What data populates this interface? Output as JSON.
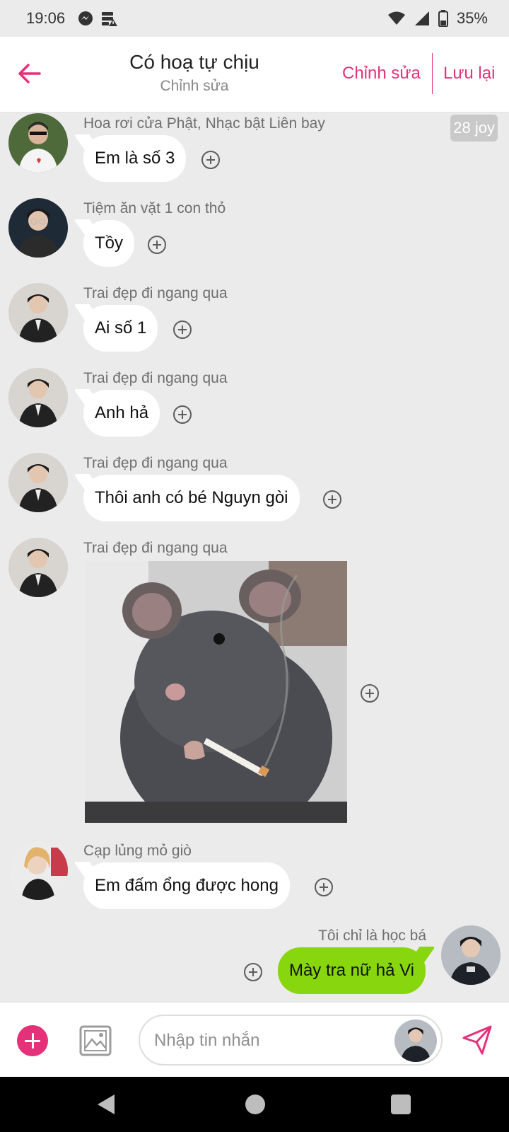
{
  "status": {
    "time": "19:06",
    "battery": "35%",
    "icons": [
      "messenger-icon",
      "storage-alert-icon",
      "wifi-icon",
      "signal-icon",
      "battery-icon"
    ]
  },
  "header": {
    "title": "Có hoạ tự chịu",
    "subtitle": "Chỉnh sửa",
    "edit_label": "Chỉnh sửa",
    "save_label": "Lưu lại"
  },
  "badge": "28 joy",
  "messages": [
    {
      "sender": "Hoa rơi cửa Phật, Nhạc bật Liên bay",
      "text": "Em là số 3"
    },
    {
      "sender": "Tiệm ăn vặt 1 con thỏ",
      "text": "Tồy"
    },
    {
      "sender": "Trai đẹp đi ngang qua",
      "text": "Ai số 1"
    },
    {
      "sender": "Trai đẹp đi ngang qua",
      "text": "Anh hả"
    },
    {
      "sender": "Trai đẹp đi ngang qua",
      "text": "Thôi anh có bé Nguyn gòi"
    },
    {
      "sender": "Trai đẹp đi ngang qua",
      "image": "rat-smoking-photo"
    },
    {
      "sender": "Cạp lủng mỏ giò",
      "text": "Em đấm ổng được hong"
    },
    {
      "sender": "Tôi chỉ là học bá",
      "text": "Mày tra nữ hả Vi",
      "outgoing": true
    }
  ],
  "input": {
    "placeholder": "Nhập tin nhắn"
  },
  "colors": {
    "accent": "#e4317a",
    "outgoing_bubble": "#88d60e",
    "background": "#ebebeb"
  }
}
